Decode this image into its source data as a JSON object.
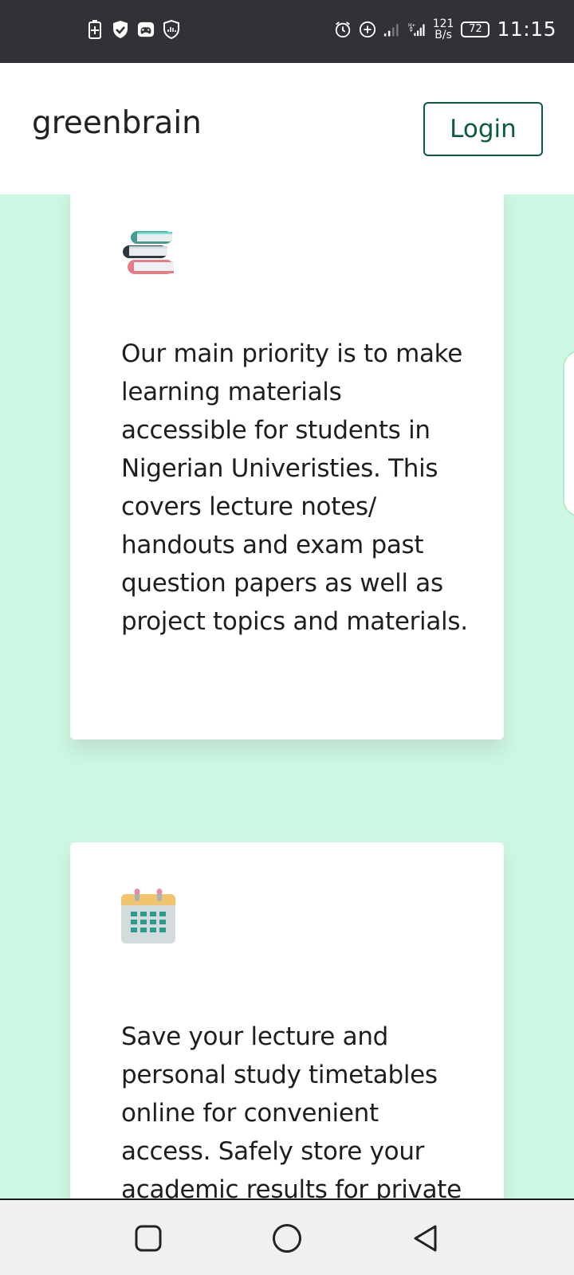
{
  "status_bar": {
    "left_icons": [
      "battery-saver-icon",
      "shield-check-icon",
      "game-controller-icon",
      "shield-signal-icon"
    ],
    "right_icons": [
      "alarm-icon",
      "data-saver-icon",
      "signal-icon",
      "signal-hplus-icon"
    ],
    "net_speed_value": "121",
    "net_speed_unit": "B/s",
    "battery_level": "72",
    "time": "11:15"
  },
  "header": {
    "brand": "greenbrain",
    "login_label": "Login"
  },
  "cards": [
    {
      "icon": "books-icon",
      "text": "Our main priority is to make learning materials accessible for students in Nigerian Univeristies. This covers lecture notes/ handouts and exam past question papers as well as project topics and materials."
    },
    {
      "icon": "calendar-icon",
      "text": "Save your lecture and personal study timetables online for convenient access. Safely store your academic results for private"
    }
  ],
  "nav_bar": {
    "buttons": [
      "recents-square-icon",
      "home-circle-icon",
      "back-triangle-icon"
    ]
  },
  "colors": {
    "page_background": "#cdf7e2",
    "brand_green": "#0c5c3a",
    "status_bar": "#303235"
  }
}
